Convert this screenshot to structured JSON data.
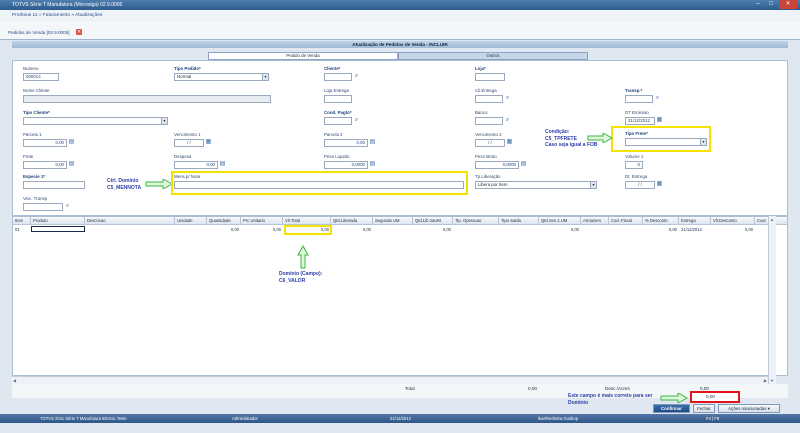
{
  "window": {
    "title": "TOTVS Série T Manufatura (Microsiga) 02.9.0005",
    "close_label": "✕",
    "max_label": "□",
    "min_label": "–"
  },
  "breadcrumb": "Protheus 11 » Faturamento » Atualizações",
  "doc_tab": {
    "label": "Pedidos de Venda [02.9.0005]",
    "close": "✕"
  },
  "form_title": "Atualização de Pedidos de Venda - INCLUIR",
  "folders": [
    {
      "label": "Pedido de Venda"
    },
    {
      "label": "Outros"
    }
  ],
  "fields": {
    "numero": {
      "label": "Numero",
      "value": "000014"
    },
    "tipo_pedido": {
      "label": "Tipo Pedido*",
      "value": "Normal"
    },
    "cliente": {
      "label": "Cliente*",
      "value": ""
    },
    "loja": {
      "label": "Loja*",
      "value": ""
    },
    "nome_cliente": {
      "label": "Nome Cliente",
      "value": ""
    },
    "loja_entrega": {
      "label": "Loja Entrega",
      "value": ""
    },
    "cli_entrega": {
      "label": "Cli.Entrega",
      "value": ""
    },
    "transp": {
      "label": "Transp.*",
      "value": ""
    },
    "tipo_cliente": {
      "label": "Tipo Cliente*",
      "value": ""
    },
    "cond_pagto": {
      "label": "Cond. Pagto*",
      "value": ""
    },
    "banco": {
      "label": "Banco",
      "value": ""
    },
    "dt_emissao": {
      "label": "DT Emissao",
      "value": "21/12/2012"
    },
    "parcela1": {
      "label": "Parcela 1",
      "value": "0,00"
    },
    "vencimento1": {
      "label": "Vencimento 1",
      "value": "/ /"
    },
    "parcela2": {
      "label": "Parcela 2",
      "value": "0,00"
    },
    "vencimento2": {
      "label": "Vencimento 2",
      "value": "/ /"
    },
    "tipo_frete": {
      "label": "Tipo Frete*",
      "value": ""
    },
    "frete": {
      "label": "Frete",
      "value": "0,00"
    },
    "despesa": {
      "label": "Despesa",
      "value": "0,00"
    },
    "peso_liquido": {
      "label": "Peso Liquido",
      "value": "0,0000"
    },
    "peso_bruto": {
      "label": "Peso Bruto",
      "value": "0,0000"
    },
    "volume1": {
      "label": "Volume 1",
      "value": "0"
    },
    "especie1": {
      "label": "Especie 1*",
      "value": ""
    },
    "mens_nota": {
      "label": "Mens.p/ Nota",
      "value": ""
    },
    "tp_liberacao": {
      "label": "Tp.Liberação",
      "value": "Libera por Item"
    },
    "dt_entrega": {
      "label": "Dt. Entrega",
      "value": "/ /"
    },
    "veic_transp": {
      "label": "Veic. Transp",
      "value": ""
    }
  },
  "annotations": {
    "tipo_frete_note": [
      "Condição:",
      "C5_TPFRETE",
      "Caso seja igual a FOB"
    ],
    "mennota_note": [
      "Ctrl. Dominio",
      "C5_MENNOTA"
    ],
    "valor_note": [
      "Dominio (Campo):",
      "C6_VALOR"
    ],
    "total_note": [
      "Este campo é mais correto para ser",
      "Dominio"
    ]
  },
  "grid": {
    "columns": [
      "Item",
      "Produto",
      "Descricao",
      "Unidade",
      "Quantidade",
      "Prc Unitario",
      "Vlr.Total",
      "Qtd.Liberada",
      "Segunda UM",
      "Qtd.Lib 2aUM",
      "Tip. Operacao",
      "Tipo Saida",
      "Qtd.Ven 2 UM",
      "Armazem",
      "Cod. Fiscal",
      "% Desconto",
      "Entrega",
      "Vlr.Desconto",
      "Cust"
    ],
    "row": [
      "01",
      "",
      "",
      "",
      "0,00",
      "0,00",
      "0,00",
      "0,00",
      "",
      "0,00",
      "",
      "",
      "0,00",
      "",
      "",
      "0,00",
      "21/12/2012",
      "0,00",
      ""
    ]
  },
  "totals": {
    "total_label": "Total",
    "total_value": "0,00",
    "desc_label": "Desc./Acres",
    "desc_value": "0,00",
    "box_value": "0,00"
  },
  "buttons": {
    "confirmar": "Confirmar",
    "fechar": "Fechar",
    "acoes": "Ações relacionadas"
  },
  "statusbar": {
    "product": "TOTVS 2011 Série T Manufatura 8SGUL Teste",
    "user": "Administrador",
    "date": "21/12/2012",
    "env": "Ikar/Redreira Gusbop",
    "keys": "F4 | F8"
  },
  "colors": {
    "highlight": "#f4e200",
    "annotation": "#2b3ea8",
    "arrow": "#3cb83c",
    "redbox": "#e0141b"
  }
}
